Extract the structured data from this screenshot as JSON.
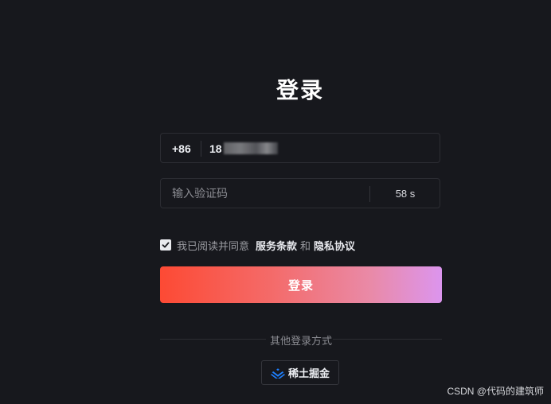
{
  "page": {
    "title": "登录"
  },
  "phone": {
    "country_code": "+86",
    "value_visible": "18"
  },
  "code": {
    "placeholder": "输入验证码",
    "countdown": "58 s"
  },
  "agreement": {
    "checked": true,
    "prefix": "我已阅读并同意",
    "terms_link": "服务条款",
    "and": "和",
    "privacy_link": "隐私协议"
  },
  "login_button": {
    "label": "登录"
  },
  "other_login": {
    "label": "其他登录方式",
    "juejin_label": "稀土掘金",
    "icon": "juejin-logo-icon"
  },
  "watermark": {
    "text": "CSDN @代码的建筑师"
  },
  "colors": {
    "background": "#17181d",
    "button_gradient_start": "#fd4a34",
    "button_gradient_end": "#dc95ee",
    "juejin_blue": "#1e80ff"
  }
}
